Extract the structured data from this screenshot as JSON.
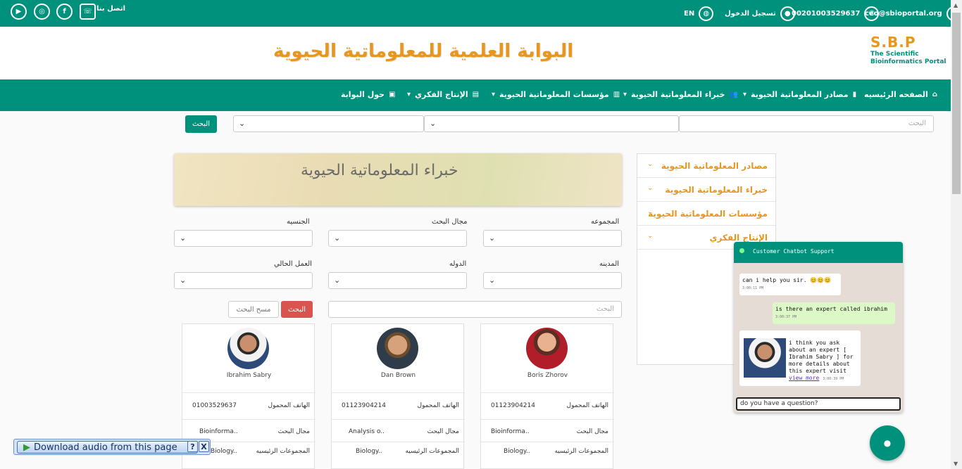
{
  "topbar": {
    "email": "ceo@sbioportal.org",
    "phone": "00201003529637",
    "login": "تسجيل الدخول",
    "lang": "EN",
    "contact_us": "اتصل بنا"
  },
  "header": {
    "site_title": "البوابة العلمية للمعلوماتية الحيوية",
    "logo_main": "S.B.P",
    "logo_line1": "The Scientific",
    "logo_line2": "Bioinformatics Portal"
  },
  "nav": {
    "home": "الصفحه الرئيسيه",
    "sources": "مصادر المعلوماتية الحيوية",
    "experts": "خبراء المعلوماتية الحيوية",
    "institutions": "مؤسسات المعلوماتية الحيوية",
    "output": "الإنتاج الفكري",
    "about": "حول البوابة"
  },
  "search": {
    "placeholder": "البحث",
    "button": "البحث"
  },
  "sidebar": {
    "items": [
      {
        "label": "مصادر المعلوماتية الحيوية"
      },
      {
        "label": "خبراء المعلوماتية الحيوية"
      },
      {
        "label": "مؤسسات المعلوماتية الحيوية"
      },
      {
        "label": "الإنتاج الفكري"
      }
    ]
  },
  "banner": {
    "title": "خبراء المعلوماتية الحيوية"
  },
  "filters": {
    "group": "المجموعه",
    "field": "مجال البحث",
    "nationality": "الجنسيه",
    "city": "المدينه",
    "country": "الدوله",
    "job": "العمل الحالي",
    "search_placeholder": "البحث",
    "search_button": "البحث",
    "clear_button": "مسح البحث"
  },
  "cards": [
    {
      "name": "Boris Zhorov",
      "phone_label": "الهاتف المحمول",
      "phone": "01123904214",
      "field_label": "مجال البحث",
      "field": "Bioinforma..",
      "group_label": "المجموعات الرئيسيه",
      "group": "Biology.."
    },
    {
      "name": "Dan Brown",
      "phone_label": "الهاتف المحمول",
      "phone": "01123904214",
      "field_label": "مجال البحث",
      "field": "Analysis o..",
      "group_label": "المجموعات الرئيسيه",
      "group": "Biology.."
    },
    {
      "name": "Ibrahim Sabry",
      "phone_label": "الهاتف المحمول",
      "phone": "01003529637",
      "field_label": "مجال البحث",
      "field": "Bioinforma..",
      "group_label": "المجموعات الرئيسيه",
      "group": "Biology.."
    }
  ],
  "chat": {
    "title": "Customer Chatbot Support",
    "msg1": "can i help you sir. 😊😊😊",
    "msg1_time": "3:00:11 PM",
    "msg2": "is there an expert called ibrahim",
    "msg2_time": "3:00:37 PM",
    "msg3": "i think you ask about an expert [ Ibrahim Sabry ] for more details about this expert visit",
    "msg3_link": "view more",
    "msg3_time": "3:00:39 PM",
    "input_value": "do you have a question?"
  },
  "audio": {
    "label": "Download audio from this page",
    "help": "?",
    "close": "X"
  }
}
